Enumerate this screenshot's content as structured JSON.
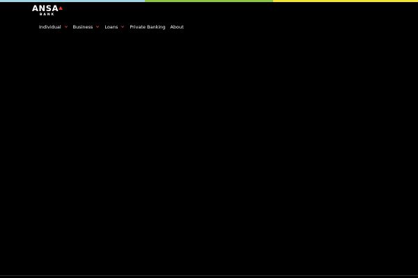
{
  "topbar": {
    "colors": [
      "#9ed4e8",
      "#8dc63f",
      "#f5e52a"
    ]
  },
  "brand": {
    "name": "ANSA",
    "sub": "BANK",
    "accent": "#e3342f"
  },
  "nav": {
    "items": [
      {
        "label": "Individual",
        "icon": "chevron-down-icon"
      },
      {
        "label": "Business",
        "icon": "chevron-down-icon"
      },
      {
        "label": "Loans",
        "icon": "chevron-down-icon"
      },
      {
        "label": "Private Banking"
      },
      {
        "label": "About"
      }
    ],
    "chevron_color": "#e3342f"
  }
}
